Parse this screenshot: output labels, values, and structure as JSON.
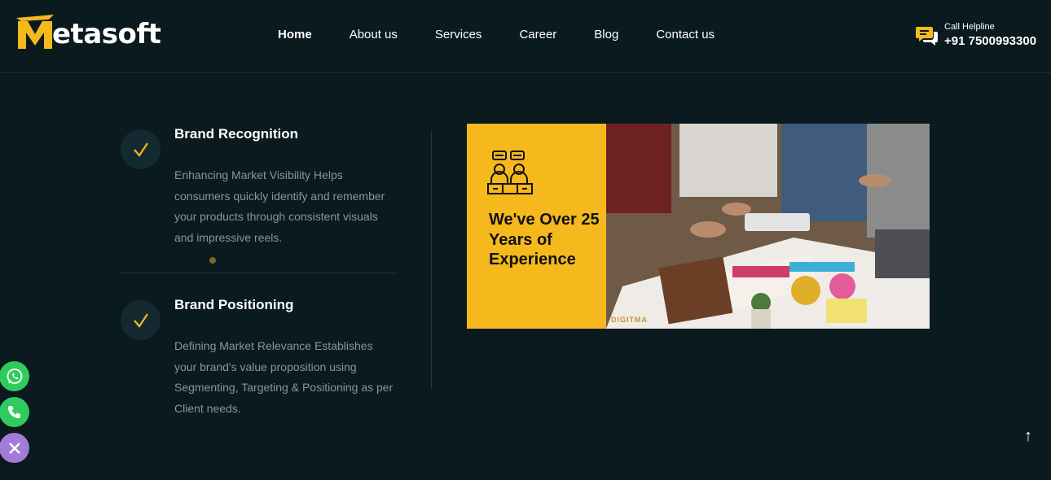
{
  "brand": {
    "logo_text": "etasoft",
    "accent": "#f6b91d"
  },
  "nav": {
    "items": [
      {
        "label": "Home",
        "active": true
      },
      {
        "label": "About us",
        "active": false
      },
      {
        "label": "Services",
        "active": false
      },
      {
        "label": "Career",
        "active": false
      },
      {
        "label": "Blog",
        "active": false
      },
      {
        "label": "Contact us",
        "active": false
      }
    ]
  },
  "helpline": {
    "label": "Call Helpline",
    "number": "+91 7500993300",
    "icon": "chat-bubbles-icon"
  },
  "features": [
    {
      "title": "Brand Recognition",
      "description": "Enhancing Market Visibility Helps consumers quickly identify and remember your products through consistent visuals and impressive reels.",
      "icon": "check-icon"
    },
    {
      "title": "Brand Positioning",
      "description": "Defining Market Relevance Establishes your brand's value proposition using Segmenting, Targeting & Positioning as per Client needs.",
      "icon": "check-icon"
    }
  ],
  "banner": {
    "headline": "We've Over 25 Years of Experience",
    "watermark": "DIGITMA",
    "icon": "team-meeting-icon"
  },
  "floating": {
    "whatsapp": "whatsapp-icon",
    "phone": "phone-icon",
    "close": "close-icon",
    "scroll_top": "↑"
  },
  "colors": {
    "background": "#0a1a1e",
    "whatsapp": "#2ecc5e",
    "close": "#a27bd8",
    "muted_text": "#8a9599"
  }
}
